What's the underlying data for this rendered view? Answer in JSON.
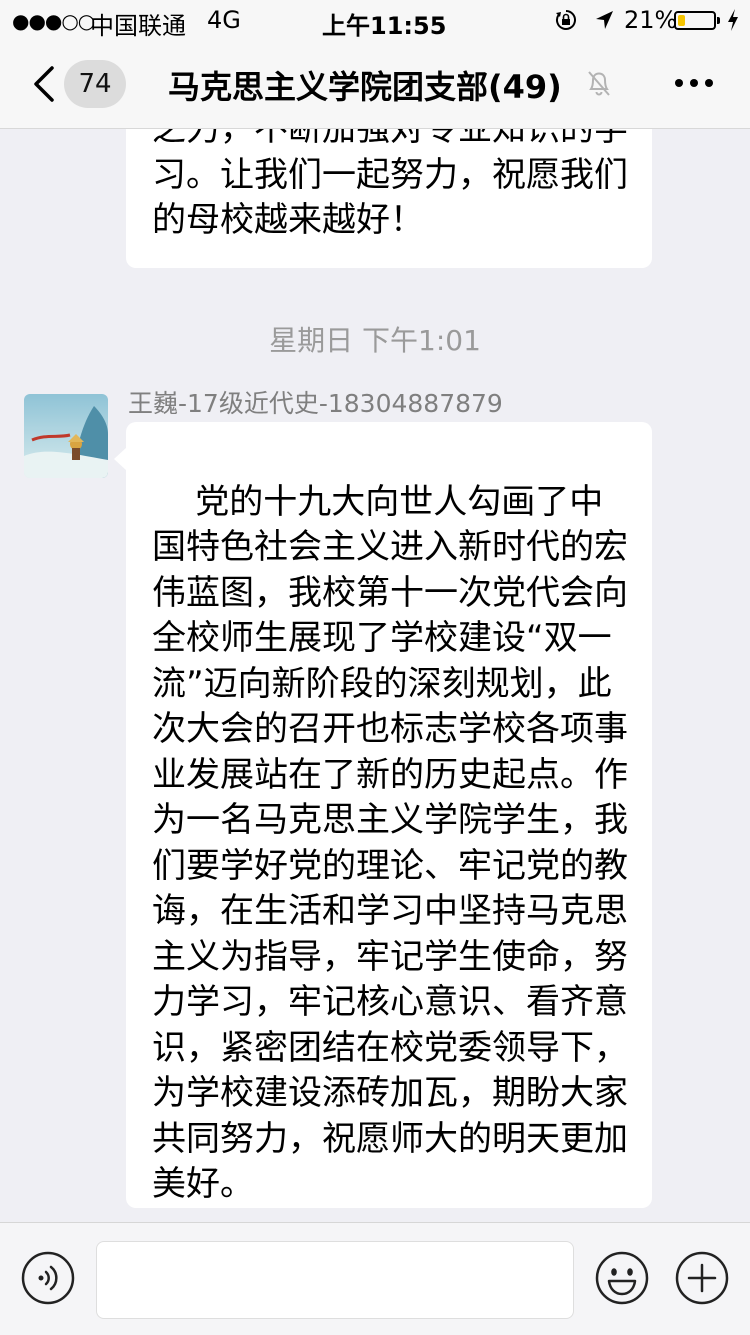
{
  "status_bar": {
    "signal": "●●●○○",
    "carrier": "中国联通",
    "network": "4G",
    "time": "上午11:55",
    "battery_percent": "21%",
    "battery_level": 0.21
  },
  "nav": {
    "unread_count": "74",
    "title": "马克思主义学院团支部(49)"
  },
  "messages": {
    "previous_text": "之力，不断加强对专业知识的学习。让我们一起努力，祝愿我们的母校越来越好！",
    "timestamp": "星期日 下午1:01",
    "sender_name": "王巍-17级近代史-18304887879",
    "main_text": "党的十九大向世人勾画了中国特色社会主义进入新时代的宏伟蓝图，我校第十一次党代会向全校师生展现了学校建设“双一流”迈向新阶段的深刻规划，此次大会的召开也标志学校各项事业发展站在了新的历史起点。作为一名马克思主义学院学生，我们要学好党的理论、牢记党的教诲，在生活和学习中坚持马克思主义为指导，牢记学生使命，努力学习，牢记核心意识、看齐意识，紧密团结在校党委领导下，为学校建设添砖加瓦，期盼大家共同努力，祝愿师大的明天更加美好。"
  },
  "input_bar": {
    "placeholder": ""
  },
  "colors": {
    "background": "#efeff4",
    "bubble": "#ffffff",
    "battery_fill": "#f5c400"
  },
  "icons": {
    "back": "chevron-left-icon",
    "mute": "bell-slash-icon",
    "more": "more-dots-icon",
    "voice": "voice-icon",
    "emoji": "smiley-icon",
    "plus": "plus-icon"
  }
}
